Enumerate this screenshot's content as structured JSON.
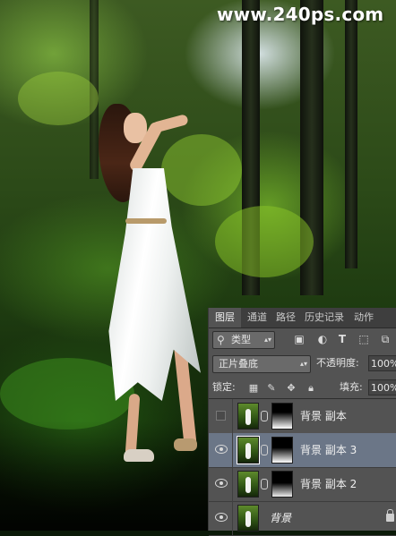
{
  "watermark": "www.240ps.com",
  "layers_panel": {
    "tabs": [
      {
        "label": "图层",
        "active": true
      },
      {
        "label": "通道",
        "active": false
      },
      {
        "label": "路径",
        "active": false
      },
      {
        "label": "历史记录",
        "active": false
      },
      {
        "label": "动作",
        "active": false
      }
    ],
    "filter": {
      "icon": "search-icon",
      "label": "类型"
    },
    "filter_icons": [
      "image-filter-icon",
      "adjustment-filter-icon",
      "type-filter-icon",
      "shape-filter-icon",
      "smart-object-filter-icon"
    ],
    "blend_mode": "正片叠底",
    "opacity_label": "不透明度:",
    "opacity_value": "100%",
    "lock_label": "锁定:",
    "lock_icons": [
      "lock-transparent-icon",
      "lock-image-icon",
      "lock-position-icon",
      "lock-all-icon"
    ],
    "fill_label": "填充:",
    "fill_value": "100%",
    "layers": [
      {
        "name": "背景 副本",
        "visible": false,
        "selected": false,
        "has_mask": true
      },
      {
        "name": "背景 副本 3",
        "visible": true,
        "selected": true,
        "has_mask": true
      },
      {
        "name": "背景 副本 2",
        "visible": true,
        "selected": false,
        "has_mask": true
      },
      {
        "name": "背景",
        "visible": true,
        "selected": false,
        "has_mask": false,
        "locked": true
      }
    ]
  },
  "colors": {
    "panel_bg": "#535353",
    "selected_layer": "#6b7687",
    "watermark": "#ffffff"
  }
}
